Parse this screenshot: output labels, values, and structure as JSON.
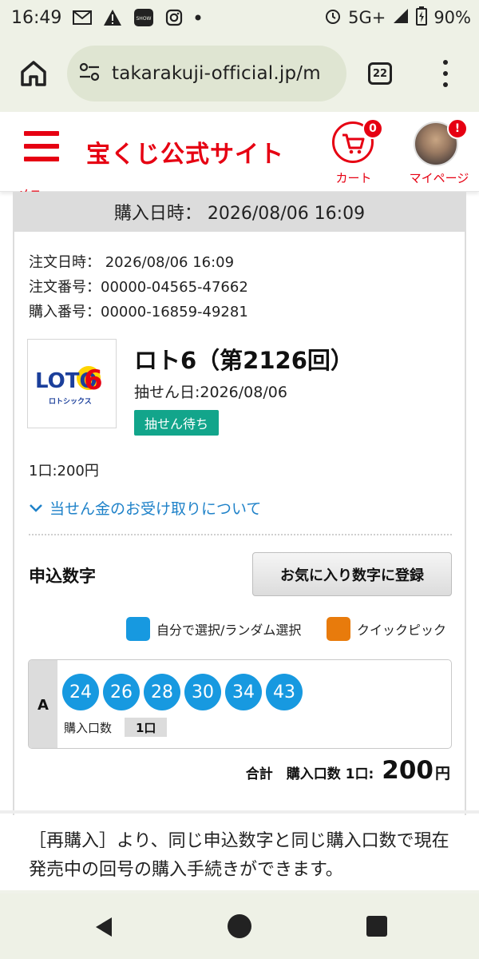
{
  "status_bar": {
    "time": "16:49",
    "network": "5G+",
    "battery": "90%",
    "icons": [
      "mail-icon",
      "warning-icon",
      "showroom-icon",
      "instagram-icon",
      "dot-icon"
    ]
  },
  "browser": {
    "url": "takarakuji-official.jp/m",
    "tab_count": "22"
  },
  "site_header": {
    "menu_label": "メニュー",
    "logo_text": "宝くじ公式サイト",
    "cart_label": "カート",
    "cart_badge": "0",
    "mypage_label": "マイページ",
    "mypage_badge": "!",
    "brand_color": "#e60012"
  },
  "purchase": {
    "purchase_datetime": "購入日時： 2026/08/06 16:09",
    "order_date": "注文日時： 2026/08/06 16:09",
    "order_number": "注文番号：00000-04565-47662",
    "purchase_number": "購入番号：00000-16859-49281"
  },
  "lottery": {
    "logo_text": "LOTO",
    "logo_number": "6",
    "logo_sub": "ロトシックス",
    "title": "ロト6（第2126回）",
    "draw_date": "抽せん日:2026/08/06",
    "status": "抽せん待ち",
    "status_color": "#12a58b"
  },
  "price_unit": "1口:200円",
  "prize_link": "当せん金のお受け取りについて",
  "numbers_section": {
    "heading": "申込数字",
    "favorite_button": "お気に入り数字に登録",
    "legend_self": "自分で選択/ランダム選択",
    "legend_quick": "クイックピック",
    "self_color": "#1799e0",
    "quick_color": "#e87b0c"
  },
  "line": {
    "letter": "A",
    "numbers": [
      "24",
      "26",
      "28",
      "30",
      "34",
      "43"
    ],
    "qty_label": "購入口数",
    "qty_value": "1口"
  },
  "total": {
    "label": "合計　購入口数 1口:",
    "amount": "200",
    "currency": "円"
  },
  "rebuy_text": "［再購入］より、同じ申込数字と同じ購入口数で現在発売中の回号の購入手続きができます。"
}
